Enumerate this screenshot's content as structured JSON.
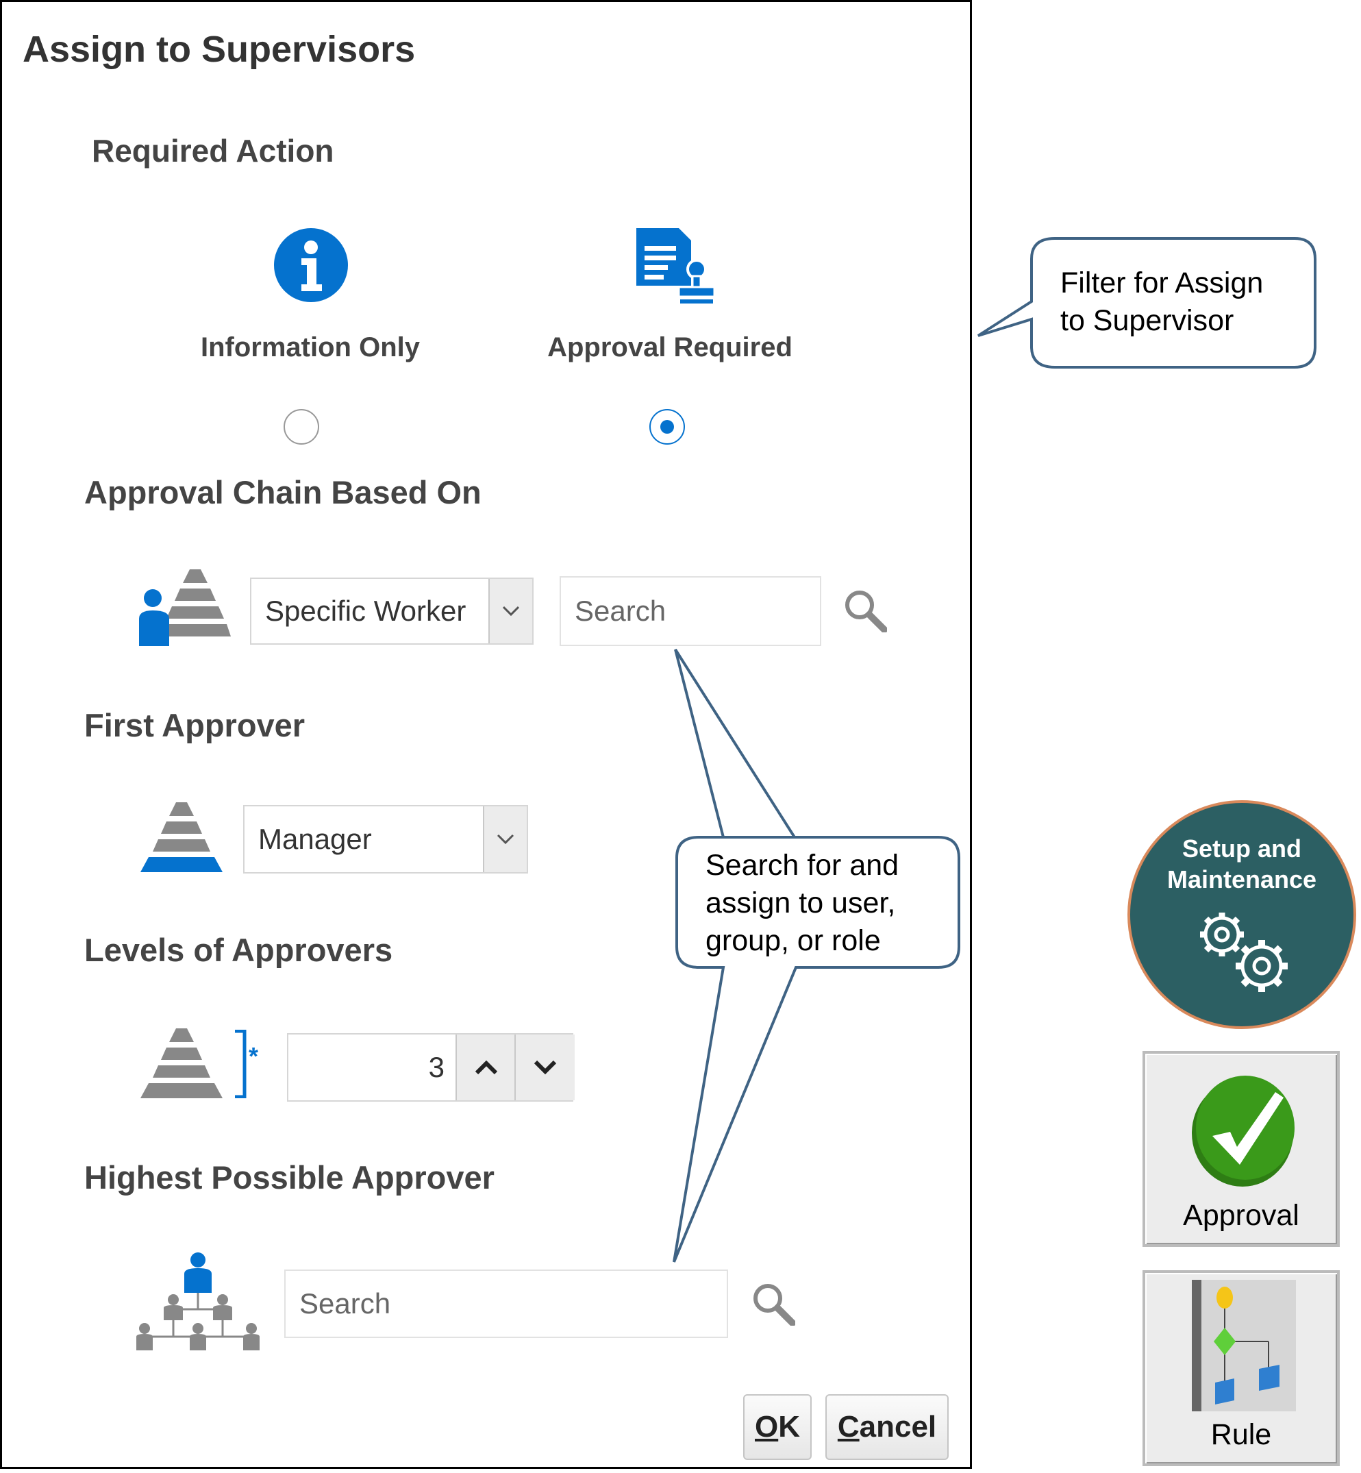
{
  "dialog": {
    "title": "Assign to Supervisors",
    "required_action": {
      "heading": "Required Action",
      "options": [
        {
          "label": "Information Only",
          "selected": false
        },
        {
          "label": "Approval Required",
          "selected": true
        }
      ]
    },
    "approval_chain": {
      "heading": "Approval Chain Based On",
      "selected": "Specific Worker",
      "search_placeholder": "Search"
    },
    "first_approver": {
      "heading": "First Approver",
      "selected": "Manager"
    },
    "levels": {
      "heading": "Levels of Approvers",
      "required_marker": "*",
      "value": "3"
    },
    "highest_approver": {
      "heading": "Highest Possible Approver",
      "search_placeholder": "Search"
    },
    "buttons": {
      "ok_accesskey": "O",
      "ok_rest": "K",
      "cancel_accesskey": "C",
      "cancel_rest": "ancel"
    }
  },
  "callouts": {
    "filter": "Filter for Assign to Supervisor",
    "search_line1": "Search for and",
    "search_line2": "assign to user,",
    "search_line3": "group, or role",
    "filter_line1": "Filter for Assign",
    "filter_line2": "to Supervisor"
  },
  "side": {
    "setup_line1": "Setup and",
    "setup_line2": "Maintenance",
    "approval_tile": "Approval",
    "rule_tile": "Rule"
  },
  "colors": {
    "accent_blue": "#0572ce",
    "setup_teal": "#2c5f63",
    "setup_border": "#d9895b",
    "callout_border": "#3f6384",
    "approval_green": "#3a9a1a"
  }
}
